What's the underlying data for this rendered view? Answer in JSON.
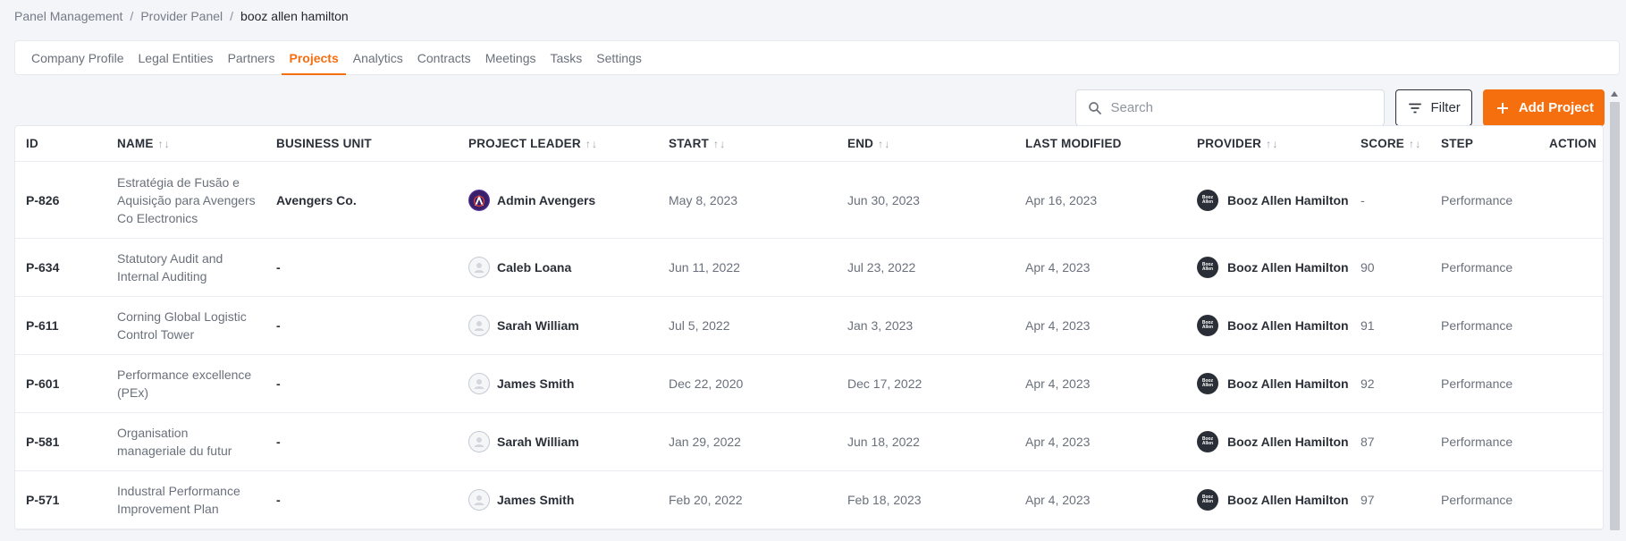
{
  "breadcrumb": {
    "items": [
      "Panel Management",
      "Provider Panel",
      "booz allen hamilton"
    ],
    "separator": "/"
  },
  "tabs": [
    "Company Profile",
    "Legal Entities",
    "Partners",
    "Projects",
    "Analytics",
    "Contracts",
    "Meetings",
    "Tasks",
    "Settings"
  ],
  "active_tab": "Projects",
  "toolbar": {
    "search_placeholder": "Search",
    "search_icon": "search-icon",
    "filter_label": "Filter",
    "filter_icon": "filter-lines-icon",
    "add_label": "Add Project",
    "add_icon": "plus-icon",
    "accent": "#f56f0e"
  },
  "table": {
    "columns": [
      "ID",
      "NAME",
      "BUSINESS UNIT",
      "PROJECT LEADER",
      "START",
      "END",
      "LAST MODIFIED",
      "PROVIDER",
      "SCORE",
      "STEP",
      "ACTION"
    ],
    "sortable": [
      "NAME",
      "PROJECT LEADER",
      "START",
      "END",
      "PROVIDER",
      "SCORE"
    ],
    "sort_glyphs": {
      "up": "↑",
      "down": "↓"
    },
    "provider_logo_text": [
      "Booz",
      "Allen"
    ],
    "rows": [
      {
        "id": "P-826",
        "name": [
          "Estratégia de Fusão e",
          "Aquisição para Avengers",
          "Co Electronics"
        ],
        "business_unit": "Avengers Co.",
        "leader": "Admin Avengers",
        "leader_avatar": "brand-logo-icon",
        "start": "May 8, 2023",
        "end": "Jun 30, 2023",
        "last_modified": "Apr 16, 2023",
        "provider": "Booz Allen Hamilton",
        "score": "-",
        "step": "Performance"
      },
      {
        "id": "P-634",
        "name": [
          "Statutory Audit and",
          "Internal Auditing"
        ],
        "business_unit": "-",
        "leader": "Caleb Loana",
        "leader_avatar": "user-avatar-icon",
        "start": "Jun 11, 2022",
        "end": "Jul 23, 2022",
        "last_modified": "Apr 4, 2023",
        "provider": "Booz Allen Hamilton",
        "score": "90",
        "step": "Performance"
      },
      {
        "id": "P-611",
        "name": [
          "Corning Global Logistic",
          "Control Tower"
        ],
        "business_unit": "-",
        "leader": "Sarah William",
        "leader_avatar": "user-avatar-icon",
        "start": "Jul 5, 2022",
        "end": "Jan 3, 2023",
        "last_modified": "Apr 4, 2023",
        "provider": "Booz Allen Hamilton",
        "score": "91",
        "step": "Performance"
      },
      {
        "id": "P-601",
        "name": [
          "Performance excellence",
          "(PEx)"
        ],
        "business_unit": "-",
        "leader": "James Smith",
        "leader_avatar": "user-avatar-icon",
        "start": "Dec 22, 2020",
        "end": "Dec 17, 2022",
        "last_modified": "Apr 4, 2023",
        "provider": "Booz Allen Hamilton",
        "score": "92",
        "step": "Performance"
      },
      {
        "id": "P-581",
        "name": [
          "Organisation",
          "manageriale du futur"
        ],
        "business_unit": "-",
        "leader": "Sarah William",
        "leader_avatar": "user-avatar-icon",
        "start": "Jan 29, 2022",
        "end": "Jun 18, 2022",
        "last_modified": "Apr 4, 2023",
        "provider": "Booz Allen Hamilton",
        "score": "87",
        "step": "Performance"
      },
      {
        "id": "P-571",
        "name": [
          "Industral Performance",
          "Improvement Plan"
        ],
        "business_unit": "-",
        "leader": "James Smith",
        "leader_avatar": "user-avatar-icon",
        "start": "Feb 20, 2022",
        "end": "Feb 18, 2023",
        "last_modified": "Apr 4, 2023",
        "provider": "Booz Allen Hamilton",
        "score": "97",
        "step": "Performance"
      }
    ]
  }
}
